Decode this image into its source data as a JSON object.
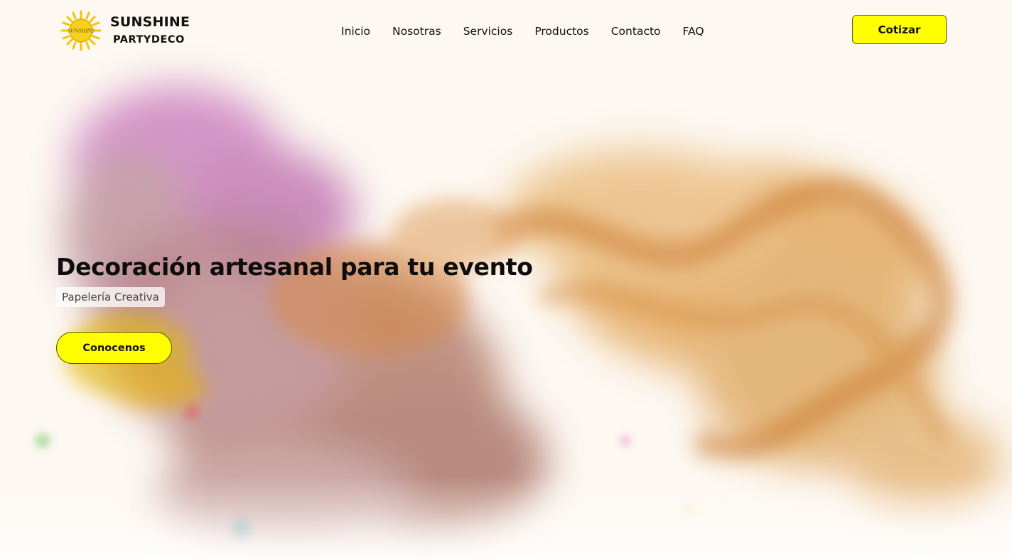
{
  "brand": {
    "name": "SUNSHINE",
    "subtitle": "PARTYDECO",
    "logo_text": "SUNSHINE",
    "logo_icon": "sun-icon"
  },
  "nav": {
    "items": [
      {
        "label": "Inicio"
      },
      {
        "label": "Nosotras"
      },
      {
        "label": "Servicios"
      },
      {
        "label": "Productos"
      },
      {
        "label": "Contacto"
      },
      {
        "label": "FAQ"
      }
    ],
    "cta_label": "Cotizar"
  },
  "hero": {
    "title": "Decoración artesanal para tu evento",
    "badge": "Papelería Creativa",
    "button_label": "Conocenos"
  },
  "colors": {
    "accent": "#ffff00",
    "background": "#fdf8f2",
    "smoke_pink": "#c060b0",
    "smoke_orange": "#d8953a",
    "smoke_yellow": "#e6b400"
  }
}
